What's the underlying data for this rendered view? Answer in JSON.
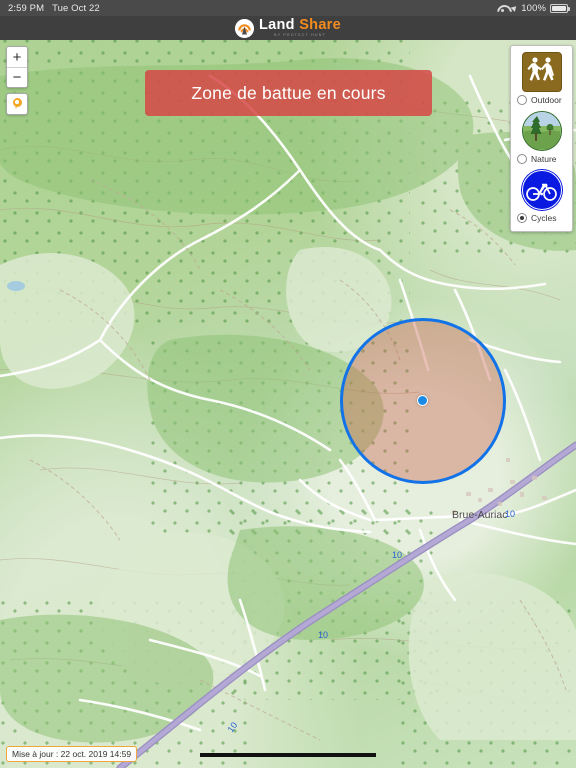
{
  "status_bar": {
    "time": "2:59 PM",
    "date": "Tue Oct 22",
    "wifi_icon": "wifi-icon",
    "location_icon": "location-arrow-icon",
    "battery_percent": "100%",
    "battery_icon": "battery-full-icon"
  },
  "header": {
    "logo_icon": "land-share-logo-icon",
    "brand_primary": "Land",
    "brand_secondary": "Share",
    "tagline": "BY PROTECT HUNT"
  },
  "map_controls": {
    "zoom_in_label": "+",
    "zoom_out_label": "−",
    "locate_icon": "map-pin-icon"
  },
  "alert": {
    "text": "Zone de battue en cours",
    "color": "#d64545"
  },
  "layers": {
    "items": [
      {
        "label": "Outdoor",
        "icon": "hikers-sign-icon",
        "selected": false
      },
      {
        "label": "Nature",
        "icon": "nature-landscape-icon",
        "selected": false
      },
      {
        "label": "Cycles",
        "icon": "bicycle-sign-icon",
        "selected": true
      }
    ]
  },
  "map": {
    "place_label": "Brue-Auriac",
    "road_shields": [
      "10",
      "10",
      "10",
      "10"
    ],
    "zone_fill": "#c85a46",
    "zone_stroke": "#1272e8",
    "user_position_icon": "user-location-dot"
  },
  "footer": {
    "update_text": "Mise à jour : 22 oct. 2019 14:59",
    "scale_bar_name": "map-scale-bar"
  }
}
